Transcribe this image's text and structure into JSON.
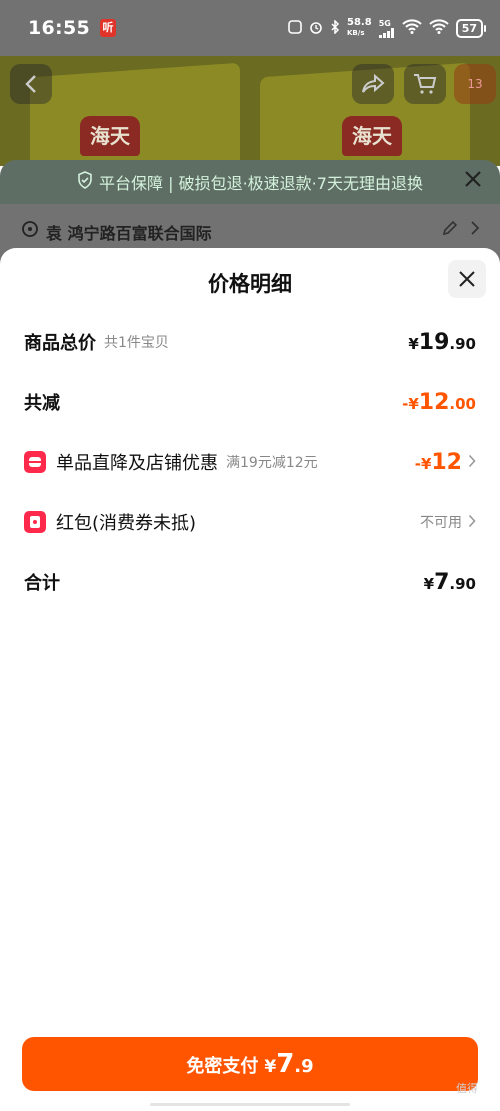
{
  "status_bar": {
    "time": "16:55",
    "app_badge": "听",
    "net_speed": "58.8",
    "net_unit": "KB/s",
    "network": "5G",
    "battery": "57"
  },
  "background": {
    "brand_logo": "海天",
    "cart_badge": "13",
    "guarantee_text": "平台保障 | 破损包退·极速退款·7天无理由退换",
    "address": "袁 鸿宁路百富联合国际"
  },
  "sheet": {
    "title": "价格明细",
    "rows": {
      "total_goods": {
        "label": "商品总价",
        "sub": "共1件宝贝",
        "yen": "¥",
        "int": "19",
        "dec": ".90"
      },
      "reduction": {
        "label": "共减",
        "prefix": "-",
        "yen": "¥",
        "int": "12",
        "dec": ".00"
      },
      "store_discount": {
        "label": "单品直降及店铺优惠",
        "sub": "满19元减12元",
        "prefix": "-",
        "yen": "¥",
        "int": "12"
      },
      "red_packet": {
        "label": "红包(消费券未抵)",
        "status": "不可用"
      },
      "sum": {
        "label": "合计",
        "yen": "¥",
        "int": "7",
        "dec": ".90"
      }
    },
    "pay_button": {
      "label": "免密支付",
      "yen": "¥",
      "int": "7",
      "dec": ".9"
    },
    "watermark": "值得"
  },
  "icons": [
    "back-icon",
    "share-icon",
    "cart-icon",
    "shield-check-icon",
    "close-icon",
    "location-pin-icon",
    "edit-icon",
    "chevron-right-icon",
    "discount-tag-icon",
    "red-packet-icon"
  ],
  "colors": {
    "accent": "#ff5500",
    "icon_red": "#ff2a4b",
    "guarantee_green": "#d3f1dc"
  }
}
